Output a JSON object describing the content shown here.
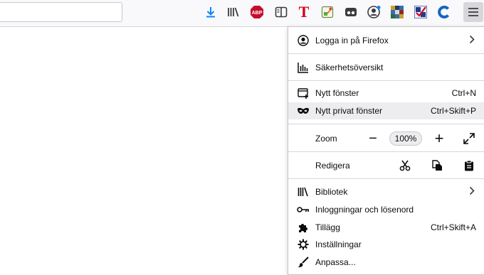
{
  "toolbar": {
    "icons": [
      "download-icon",
      "library-icon",
      "adblock-icon",
      "reader-view-icon",
      "text-t-icon",
      "color-picker-icon",
      "private-mask-icon",
      "account-icon",
      "pixel-extension-icon",
      "checker-extension-icon",
      "c-extension-icon",
      "hamburger-menu-icon"
    ],
    "abp_text": "ABP",
    "t_text": "T"
  },
  "menu": {
    "sign_in": "Logga in på Firefox",
    "security": "Säkerhetsöversikt",
    "new_window": {
      "label": "Nytt fönster",
      "shortcut": "Ctrl+N"
    },
    "private_window": {
      "label": "Nytt privat fönster",
      "shortcut": "Ctrl+Skift+P"
    },
    "zoom": {
      "label": "Zoom",
      "minus": "−",
      "value": "100%",
      "plus": "+"
    },
    "edit": {
      "label": "Redigera"
    },
    "library": "Bibliotek",
    "logins": "Inloggningar och lösenord",
    "addons": {
      "label": "Tillägg",
      "shortcut": "Ctrl+Skift+A"
    },
    "settings": "Inställningar",
    "customize": "Anpassa..."
  },
  "colors": {
    "accent": "#0a84ff",
    "abp_red": "#c70d2c",
    "t_red": "#d70022"
  }
}
